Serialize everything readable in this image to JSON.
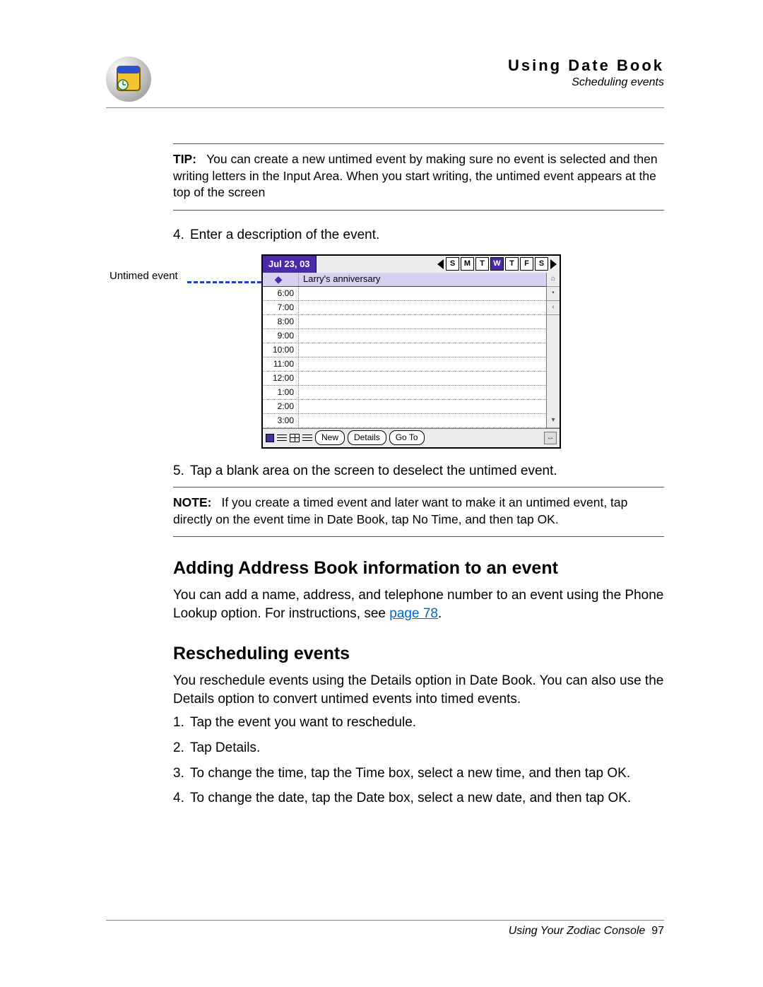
{
  "header": {
    "title": "Using Date Book",
    "subtitle": "Scheduling events"
  },
  "tip": {
    "label": "TIP:",
    "text": "You can create a new untimed event by making sure no event is selected and then writing letters in the Input Area. When you start writing, the untimed event appears at the top of the screen"
  },
  "step4": {
    "num": "4.",
    "text": "Enter a description of the event."
  },
  "callout": "Untimed event",
  "datebook": {
    "date": "Jul 23, 03",
    "days": [
      "S",
      "M",
      "T",
      "W",
      "T",
      "F",
      "S"
    ],
    "selected_day_index": 3,
    "untimed_event": "Larry's anniversary",
    "times": [
      "6:00",
      "7:00",
      "8:00",
      "9:00",
      "10:00",
      "11:00",
      "12:00",
      "1:00",
      "2:00",
      "3:00"
    ],
    "buttons": {
      "new": "New",
      "details": "Details",
      "goto": "Go To"
    }
  },
  "step5": {
    "num": "5.",
    "text": "Tap a blank area on the screen to deselect the untimed event."
  },
  "note": {
    "label": "NOTE:",
    "text": "If you create a timed event and later want to make it an untimed event, tap directly on the event time in Date Book, tap No Time, and then tap OK."
  },
  "section1": {
    "heading": "Adding Address Book information to an event",
    "body_pre": "You can add a name, address, and telephone number to an event using the Phone Lookup option. For instructions, see ",
    "link": "page 78",
    "body_post": "."
  },
  "section2": {
    "heading": "Rescheduling events",
    "intro": "You reschedule events using the Details option in Date Book. You can also use the Details option to convert untimed events into timed events.",
    "steps": [
      {
        "num": "1.",
        "text": "Tap the event you want to reschedule."
      },
      {
        "num": "2.",
        "text": "Tap Details."
      },
      {
        "num": "3.",
        "text": "To change the time, tap the Time box, select a new time, and then tap OK."
      },
      {
        "num": "4.",
        "text": "To change the date, tap the Date box, select a new date, and then tap OK."
      }
    ]
  },
  "footer": {
    "text": "Using Your Zodiac Console",
    "page": "97"
  }
}
